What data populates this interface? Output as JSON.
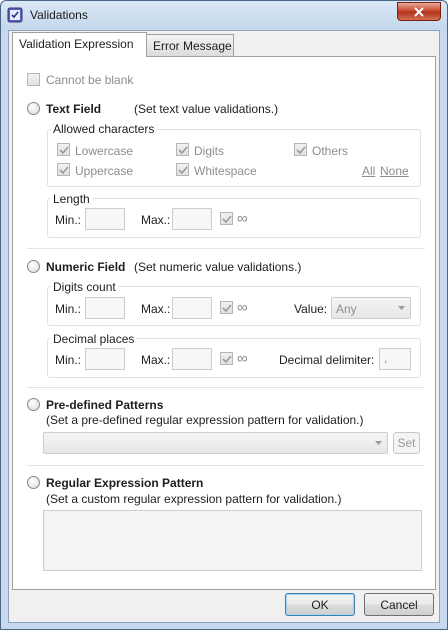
{
  "window": {
    "title": "Validations"
  },
  "tabs": [
    {
      "label": "Validation Expression",
      "active": true
    },
    {
      "label": "Error Message",
      "active": false
    }
  ],
  "cannot_be_blank": {
    "label": "Cannot be blank",
    "checked": false
  },
  "text_field": {
    "title": "Text Field",
    "description": "(Set text value validations.)",
    "allowed_characters": {
      "label": "Allowed characters",
      "options": [
        {
          "label": "Lowercase",
          "checked": true
        },
        {
          "label": "Digits",
          "checked": true
        },
        {
          "label": "Others",
          "checked": true
        },
        {
          "label": "Uppercase",
          "checked": true
        },
        {
          "label": "Whitespace",
          "checked": true
        }
      ],
      "all_link": "All",
      "none_link": "None"
    },
    "length": {
      "label": "Length",
      "min_label": "Min.:",
      "max_label": "Max.:",
      "min_value": "",
      "max_value": "",
      "infinity_checked": true,
      "infinity_symbol": "∞"
    }
  },
  "numeric_field": {
    "title": "Numeric Field",
    "description": "(Set numeric value validations.)",
    "digits_count": {
      "label": "Digits count",
      "min_label": "Min.:",
      "max_label": "Max.:",
      "min_value": "",
      "max_value": "",
      "infinity_checked": true,
      "infinity_symbol": "∞",
      "value_label": "Value:",
      "value_selected": "Any"
    },
    "decimal_places": {
      "label": "Decimal places",
      "min_label": "Min.:",
      "max_label": "Max.:",
      "min_value": "",
      "max_value": "",
      "infinity_checked": true,
      "infinity_symbol": "∞",
      "delimiter_label": "Decimal delimiter:",
      "delimiter_value": ","
    }
  },
  "predefined": {
    "title": "Pre-defined Patterns",
    "description": "(Set a pre-defined regular expression pattern for validation.)",
    "selected": "",
    "set_button": "Set"
  },
  "regex": {
    "title": "Regular Expression Pattern",
    "description": "(Set a custom regular expression pattern for validation.)",
    "value": ""
  },
  "footer": {
    "ok_label": "OK",
    "cancel_label": "Cancel"
  },
  "colors": {
    "frame": "#c7d9ee",
    "close_button": "#c7432b",
    "default_button_border": "#3c7fb1"
  },
  "icons": {
    "app": "validation-app-icon",
    "close": "close-x-icon",
    "check": "checkmark-icon",
    "dropdown": "chevron-down-icon"
  }
}
